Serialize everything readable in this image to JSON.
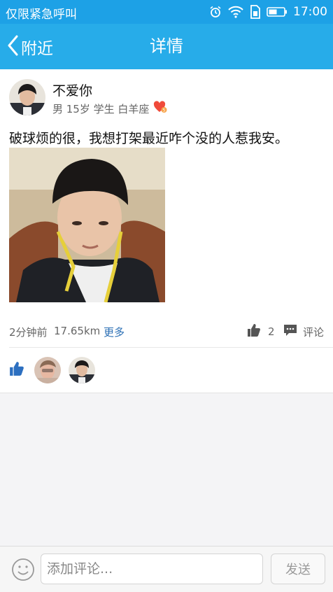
{
  "status_bar": {
    "carrier_text": "仅限紧急呼叫",
    "time": "17:00",
    "icons": [
      "alarm-icon",
      "wifi-icon",
      "sim-icon",
      "battery-icon"
    ]
  },
  "nav": {
    "back_label": "附近",
    "title": "详情"
  },
  "post": {
    "username": "不爱你",
    "meta": "男 15岁 学生 白羊座",
    "text": "破球烦的很，我想打架最近咋个没的人惹我安。",
    "time_ago": "2分钟前",
    "distance": "17.65km",
    "more_label": "更多",
    "like_count": "2",
    "comment_label": "评论"
  },
  "likers": [
    {
      "name": "liker-1"
    },
    {
      "name": "liker-2"
    }
  ],
  "composer": {
    "placeholder": "添加评论...",
    "send_label": "发送"
  },
  "colors": {
    "status_bar": "#1da1e6",
    "nav_bar": "#27ace9",
    "link": "#2b6fb5",
    "like_blue": "#2c6fc0"
  }
}
